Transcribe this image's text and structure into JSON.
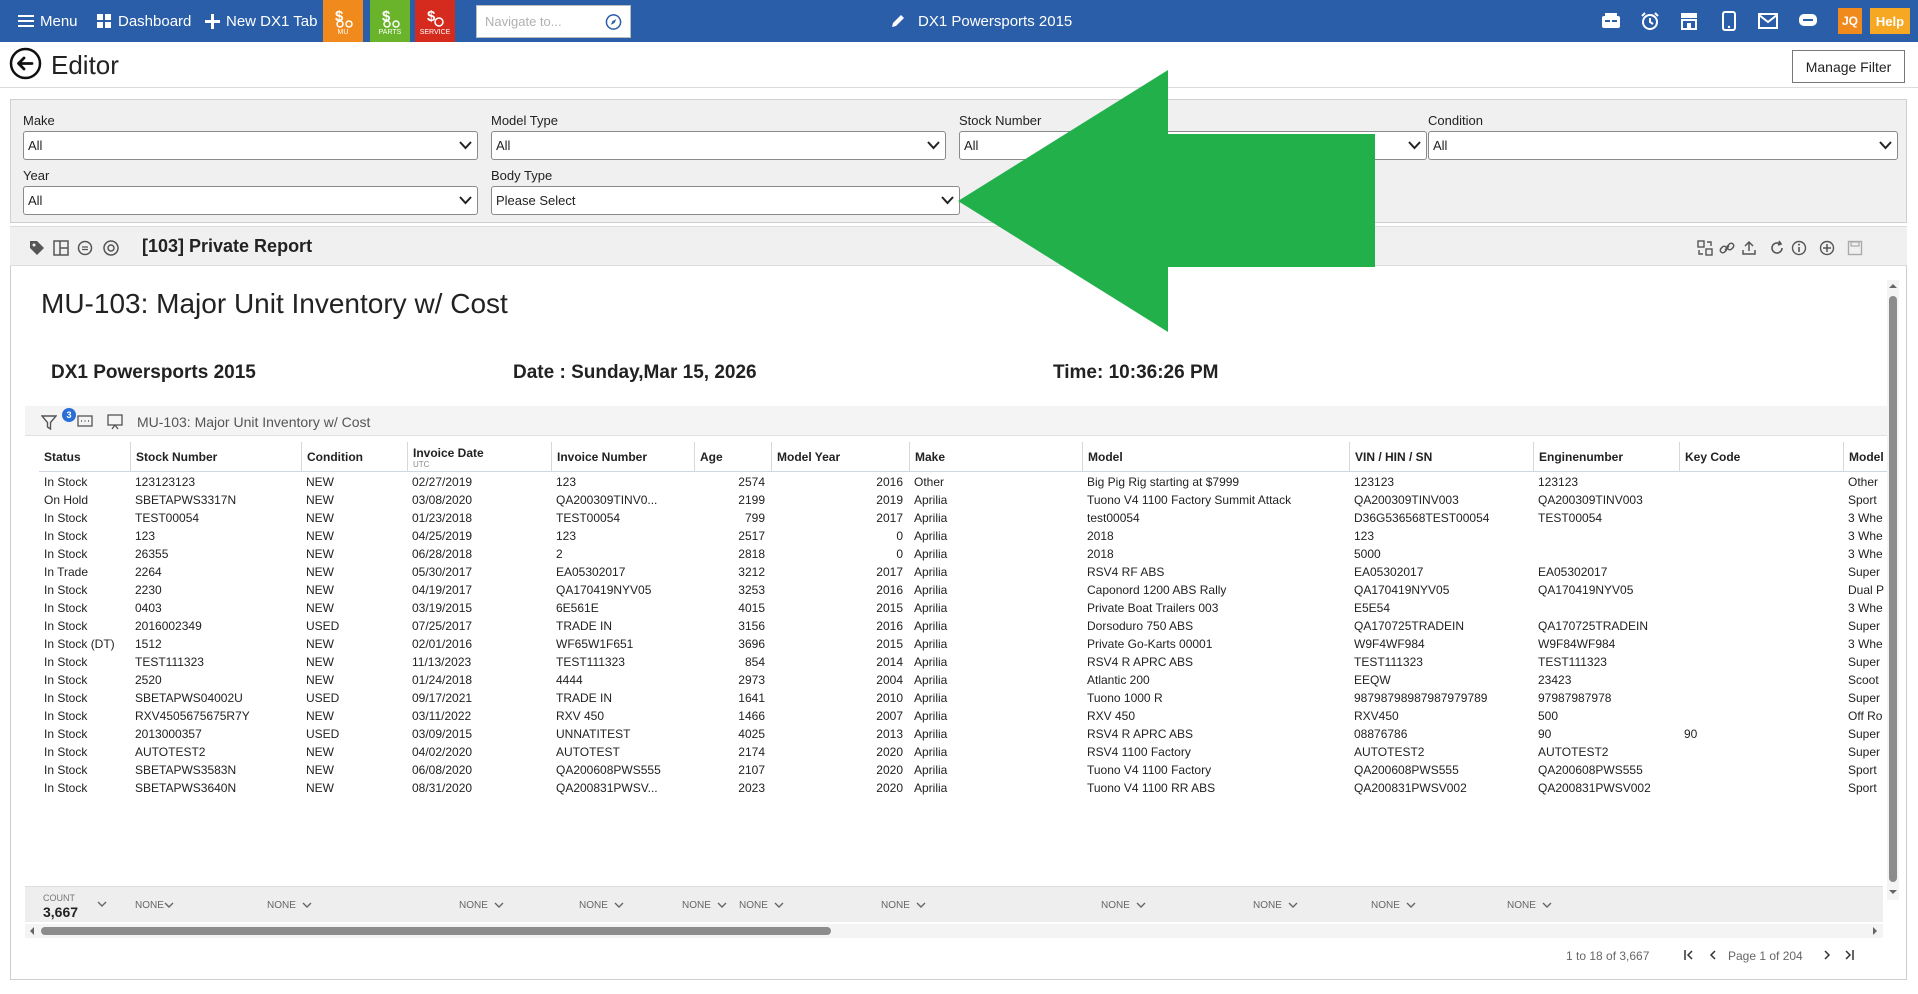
{
  "topbar": {
    "menu_label": "Menu",
    "dashboard_label": "Dashboard",
    "new_tab_label": "New DX1 Tab",
    "quick": [
      {
        "label": "MU",
        "color": "#f18a1c"
      },
      {
        "label": "PARTS",
        "color": "#6ab42c"
      },
      {
        "label": "SERVICE",
        "color": "#d52b1e"
      }
    ],
    "navigate_placeholder": "Navigate to...",
    "app_title": "DX1 Powersports 2015",
    "user_initials": "JQ",
    "help_label": "Help"
  },
  "editor": {
    "title": "Editor",
    "manage_filter_label": "Manage Filter"
  },
  "filters": {
    "make": {
      "label": "Make",
      "value": "All"
    },
    "model_type": {
      "label": "Model Type",
      "value": "All"
    },
    "stock_number": {
      "label": "Stock Number",
      "value": "All"
    },
    "condition": {
      "label": "Condition",
      "value": "All"
    },
    "year": {
      "label": "Year",
      "value": "All"
    },
    "body_type": {
      "label": "Body Type",
      "value": "Please Select"
    }
  },
  "report": {
    "name": "[103] Private Report",
    "title": "MU-103: Major Unit Inventory w/ Cost",
    "dealer": "DX1 Powersports 2015",
    "date": "Date : Sunday,Mar 15, 2026",
    "time": "Time: 10:36:26 PM",
    "grid_title": "MU-103: Major Unit Inventory w/ Cost",
    "filter_count": "3"
  },
  "table": {
    "columns": [
      "Status",
      "Stock Number",
      "Condition",
      "Invoice Date",
      "Invoice Number",
      "Age",
      "Model Year",
      "Make",
      "Model",
      "VIN / HIN / SN",
      "Enginenumber",
      "Key Code",
      "Model"
    ],
    "invoice_date_sub": "UTC",
    "rows": [
      [
        "In Stock",
        "123123123",
        "NEW",
        "02/27/2019",
        "123",
        "2574",
        "2016",
        "Other",
        "Big Pig Rig starting at $7999",
        "123123",
        "123123",
        "",
        "Other"
      ],
      [
        "On Hold",
        "SBETAPWS3317N",
        "NEW",
        "03/08/2020",
        "QA200309TINV0...",
        "2199",
        "2019",
        "Aprilia",
        "Tuono V4 1100 Factory Summit Attack",
        "QA200309TINV003",
        "QA200309TINV003",
        "",
        "Sport"
      ],
      [
        "In Stock",
        "TEST00054",
        "NEW",
        "01/23/2018",
        "TEST00054",
        "799",
        "2017",
        "Aprilia",
        "test00054",
        "D36G536568TEST00054",
        "TEST00054",
        "",
        "3 Whe"
      ],
      [
        "In Stock",
        "123",
        "NEW",
        "04/25/2019",
        "123",
        "2517",
        "0",
        "Aprilia",
        "2018",
        "123",
        "",
        "",
        "3 Whe"
      ],
      [
        "In Stock",
        "26355",
        "NEW",
        "06/28/2018",
        "2",
        "2818",
        "0",
        "Aprilia",
        "2018",
        "5000",
        "",
        "",
        "3 Whe"
      ],
      [
        "In Trade",
        "2264",
        "NEW",
        "05/30/2017",
        "EA05302017",
        "3212",
        "2017",
        "Aprilia",
        "RSV4 RF ABS",
        "EA05302017",
        "EA05302017",
        "",
        "Super"
      ],
      [
        "In Stock",
        "2230",
        "NEW",
        "04/19/2017",
        "QA170419NYV05",
        "3253",
        "2016",
        "Aprilia",
        "Caponord 1200 ABS Rally",
        "QA170419NYV05",
        "QA170419NYV05",
        "",
        "Dual P"
      ],
      [
        "In Stock",
        "0403",
        "NEW",
        "03/19/2015",
        "6E561E",
        "4015",
        "2015",
        "Aprilia",
        "Private Boat Trailers 003",
        "E5E54",
        "",
        "",
        "3 Whe"
      ],
      [
        "In Stock",
        "2016002349",
        "USED",
        "07/25/2017",
        "TRADE IN",
        "3156",
        "2016",
        "Aprilia",
        "Dorsoduro 750 ABS",
        "QA170725TRADEIN",
        "QA170725TRADEIN",
        "",
        "Super"
      ],
      [
        "In Stock (DT)",
        "1512",
        "NEW",
        "02/01/2016",
        "WF65W1F651",
        "3696",
        "2015",
        "Aprilia",
        "Private Go-Karts 00001",
        "W9F4WF984",
        "W9F84WF984",
        "",
        "3 Whe"
      ],
      [
        "In Stock",
        "TEST111323",
        "NEW",
        "11/13/2023",
        "TEST111323",
        "854",
        "2014",
        "Aprilia",
        "RSV4 R APRC ABS",
        "TEST111323",
        "TEST111323",
        "",
        "Super"
      ],
      [
        "In Stock",
        "2520",
        "NEW",
        "01/24/2018",
        "4444",
        "2973",
        "2004",
        "Aprilia",
        "Atlantic 200",
        "EEQW",
        "23423",
        "",
        "Scoot"
      ],
      [
        "In Stock",
        "SBETAPWS04002U",
        "USED",
        "09/17/2021",
        "TRADE IN",
        "1641",
        "2010",
        "Aprilia",
        "Tuono 1000 R",
        "98798798987987979789",
        "97987987978",
        "",
        "Super"
      ],
      [
        "In Stock",
        "RXV4505675675R7Y",
        "NEW",
        "03/11/2022",
        "RXV 450",
        "1466",
        "2007",
        "Aprilia",
        "RXV 450",
        "RXV450",
        "500",
        "",
        "Off Ro"
      ],
      [
        "In Stock",
        "2013000357",
        "USED",
        "03/09/2015",
        "UNNATITEST",
        "4025",
        "2013",
        "Aprilia",
        "RSV4 R APRC ABS",
        "08876786",
        "90",
        "90",
        "Super"
      ],
      [
        "In Stock",
        "AUTOTEST2",
        "NEW",
        "04/02/2020",
        "AUTOTEST",
        "2174",
        "2020",
        "Aprilia",
        "RSV4 1100 Factory",
        "AUTOTEST2",
        "AUTOTEST2",
        "",
        "Super"
      ],
      [
        "In Stock",
        "SBETAPWS3583N",
        "NEW",
        "06/08/2020",
        "QA200608PWS555",
        "2107",
        "2020",
        "Aprilia",
        "Tuono V4 1100 Factory",
        "QA200608PWS555",
        "QA200608PWS555",
        "",
        "Sport"
      ],
      [
        "In Stock",
        "SBETAPWS3640N",
        "NEW",
        "08/31/2020",
        "QA200831PWSV...",
        "2023",
        "2020",
        "Aprilia",
        "Tuono V4 1100 RR ABS",
        "QA200831PWSV002",
        "QA200831PWSV002",
        "",
        "Sport"
      ]
    ],
    "count_label": "COUNT",
    "count_value": "3,667",
    "agg_none": "NONE"
  },
  "pager": {
    "range": "1 to 18 of 3,667",
    "page": "Page 1 of 204"
  },
  "colors": {
    "topbar": "#2a5ea8",
    "arrow": "#22b04b"
  }
}
